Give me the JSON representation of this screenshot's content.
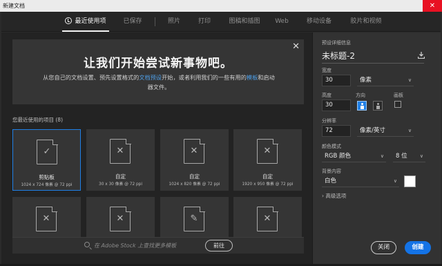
{
  "window": {
    "title": "新建文档",
    "close_glyph": "✕"
  },
  "tabs": [
    {
      "label": "最近使用项",
      "active": true
    },
    {
      "label": "已保存"
    },
    {
      "label": "照片"
    },
    {
      "label": "打印"
    },
    {
      "label": "图稿和插图"
    },
    {
      "label": "Web"
    },
    {
      "label": "移动设备"
    },
    {
      "label": "胶片和视频"
    }
  ],
  "hero": {
    "heading": "让我们开始尝试新事物吧。",
    "sub_part1": "从您自己的文档设置、预先设置格式的",
    "sub_link1": "文档预设",
    "sub_part2": "开始，或者利用我们的一些有用的",
    "sub_link2": "模板",
    "sub_part3": "和启动器文件。",
    "close_glyph": "✕"
  },
  "recent": {
    "label": "您最近使用的项目 (8)",
    "items": [
      {
        "name": "剪贴板",
        "dims": "1024 x 724 像素 @ 72 ppi",
        "icon": "check-icon",
        "glyph": "✓"
      },
      {
        "name": "自定",
        "dims": "30 x 30 像素 @ 72 ppi",
        "icon": "pen-icon",
        "glyph": "✕"
      },
      {
        "name": "自定",
        "dims": "1024 x 820 像素 @ 72 ppi",
        "icon": "pen-icon",
        "glyph": "✕"
      },
      {
        "name": "自定",
        "dims": "1920 x 950 像素 @ 72 ppi",
        "icon": "pen-icon",
        "glyph": "✕"
      },
      {
        "name": "",
        "dims": "",
        "icon": "pen-icon",
        "glyph": "✕"
      },
      {
        "name": "",
        "dims": "",
        "icon": "pen-icon",
        "glyph": "✕"
      },
      {
        "name": "",
        "dims": "",
        "icon": "vector-pen-icon",
        "glyph": "✎"
      },
      {
        "name": "",
        "dims": "",
        "icon": "pen-icon",
        "glyph": "✕"
      }
    ]
  },
  "stock": {
    "placeholder": "在 Adobe Stock 上查找更多模板",
    "go_label": "前往"
  },
  "preset": {
    "section_label": "预设详细信息",
    "name": "未标题-2",
    "width_label": "宽度",
    "width_value": "30",
    "width_unit": "像素",
    "height_label": "高度",
    "height_value": "30",
    "orientation_label": "方向",
    "artboard_label": "画板",
    "resolution_label": "分辨率",
    "resolution_value": "72",
    "resolution_unit": "像素/英寸",
    "color_mode_label": "颜色模式",
    "color_mode_value": "RGB 颜色",
    "bit_depth_value": "8 位",
    "background_label": "背景内容",
    "background_value": "白色",
    "background_color": "#ffffff",
    "advanced_label": "高级选项",
    "close_label": "关闭",
    "create_label": "创建"
  },
  "colors": {
    "accent": "#1473e6",
    "link": "#4e9ee6"
  }
}
